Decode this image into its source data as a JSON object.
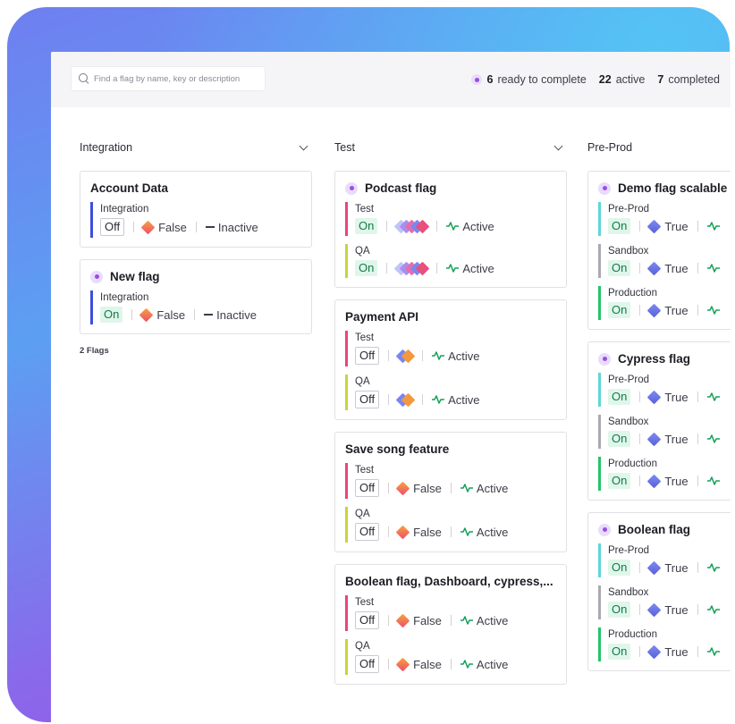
{
  "search": {
    "placeholder": "Find a flag by name, key or description"
  },
  "stats": {
    "ready_count": "6",
    "ready_label": "ready to complete",
    "active_count": "22",
    "active_label": "active",
    "completed_count": "7",
    "completed_label": "completed"
  },
  "colors": {
    "test": "#e8457a",
    "qa": "#c9d43c",
    "integration": "#3d4fdc",
    "preprod": "#5fd6d8",
    "sandbox": "#a9a9b0",
    "production": "#23c46a"
  },
  "columns": [
    {
      "title": "Integration",
      "footer": "2 Flags",
      "cards": [
        {
          "title": "Account Data",
          "dot": false,
          "envs": [
            {
              "name": "Integration",
              "color": "integration",
              "state": "Off",
              "value": "False",
              "vtype": "orange",
              "status": "Inactive"
            }
          ]
        },
        {
          "title": "New flag",
          "dot": true,
          "envs": [
            {
              "name": "Integration",
              "color": "integration",
              "state": "On",
              "value": "False",
              "vtype": "orange",
              "status": "Inactive"
            }
          ]
        }
      ]
    },
    {
      "title": "Test",
      "cards": [
        {
          "title": "Podcast flag",
          "dot": true,
          "envs": [
            {
              "name": "Test",
              "color": "test",
              "state": "On",
              "value": "",
              "vtype": "stack5",
              "status": "Active"
            },
            {
              "name": "QA",
              "color": "qa",
              "state": "On",
              "value": "",
              "vtype": "stack5",
              "status": "Active"
            }
          ]
        },
        {
          "title": "Payment API",
          "dot": false,
          "envs": [
            {
              "name": "Test",
              "color": "test",
              "state": "Off",
              "value": "",
              "vtype": "stack2",
              "status": "Active"
            },
            {
              "name": "QA",
              "color": "qa",
              "state": "Off",
              "value": "",
              "vtype": "stack2",
              "status": "Active"
            }
          ]
        },
        {
          "title": "Save song feature",
          "dot": false,
          "envs": [
            {
              "name": "Test",
              "color": "test",
              "state": "Off",
              "value": "False",
              "vtype": "orange",
              "status": "Active"
            },
            {
              "name": "QA",
              "color": "qa",
              "state": "Off",
              "value": "False",
              "vtype": "orange",
              "status": "Active"
            }
          ]
        },
        {
          "title": "Boolean flag, Dashboard, cypress,...",
          "dot": false,
          "envs": [
            {
              "name": "Test",
              "color": "test",
              "state": "Off",
              "value": "False",
              "vtype": "orange",
              "status": "Active"
            },
            {
              "name": "QA",
              "color": "qa",
              "state": "Off",
              "value": "False",
              "vtype": "orange",
              "status": "Active"
            }
          ]
        }
      ]
    },
    {
      "title": "Pre-Prod",
      "cards": [
        {
          "title": "Demo flag scalable",
          "dot": true,
          "envs": [
            {
              "name": "Pre-Prod",
              "color": "preprod",
              "state": "On",
              "value": "True",
              "vtype": "blue",
              "status": ""
            },
            {
              "name": "Sandbox",
              "color": "sandbox",
              "state": "On",
              "value": "True",
              "vtype": "blue",
              "status": ""
            },
            {
              "name": "Production",
              "color": "production",
              "state": "On",
              "value": "True",
              "vtype": "blue",
              "status": ""
            }
          ]
        },
        {
          "title": "Cypress flag",
          "dot": true,
          "envs": [
            {
              "name": "Pre-Prod",
              "color": "preprod",
              "state": "On",
              "value": "True",
              "vtype": "blue",
              "status": ""
            },
            {
              "name": "Sandbox",
              "color": "sandbox",
              "state": "On",
              "value": "True",
              "vtype": "blue",
              "status": ""
            },
            {
              "name": "Production",
              "color": "production",
              "state": "On",
              "value": "True",
              "vtype": "blue",
              "status": ""
            }
          ]
        },
        {
          "title": "Boolean flag",
          "dot": true,
          "envs": [
            {
              "name": "Pre-Prod",
              "color": "preprod",
              "state": "On",
              "value": "True",
              "vtype": "blue",
              "status": ""
            },
            {
              "name": "Sandbox",
              "color": "sandbox",
              "state": "On",
              "value": "True",
              "vtype": "blue",
              "status": ""
            },
            {
              "name": "Production",
              "color": "production",
              "state": "On",
              "value": "True",
              "vtype": "blue",
              "status": ""
            }
          ]
        }
      ]
    }
  ]
}
